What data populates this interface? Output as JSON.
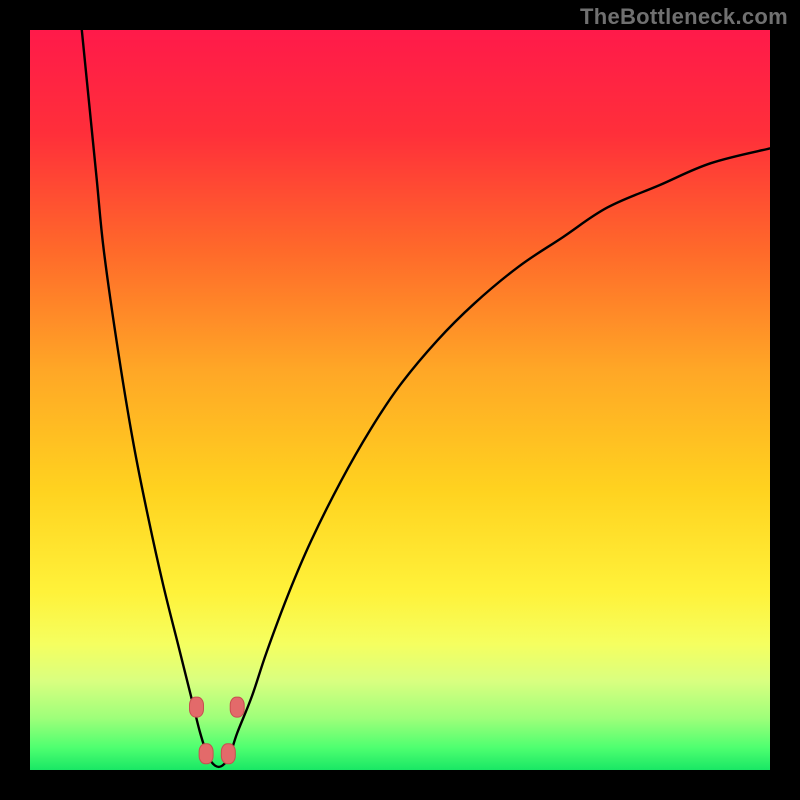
{
  "watermark": "TheBottleneck.com",
  "colors": {
    "bg": "#000000",
    "gradient_stops": [
      {
        "offset": 0.0,
        "color": "#ff1a4a"
      },
      {
        "offset": 0.14,
        "color": "#ff2f3a"
      },
      {
        "offset": 0.3,
        "color": "#ff6a2a"
      },
      {
        "offset": 0.46,
        "color": "#ffa726"
      },
      {
        "offset": 0.62,
        "color": "#ffd21f"
      },
      {
        "offset": 0.76,
        "color": "#fff23a"
      },
      {
        "offset": 0.83,
        "color": "#f5ff60"
      },
      {
        "offset": 0.88,
        "color": "#d9ff80"
      },
      {
        "offset": 0.93,
        "color": "#9eff7a"
      },
      {
        "offset": 0.97,
        "color": "#4eff70"
      },
      {
        "offset": 1.0,
        "color": "#19e765"
      }
    ],
    "curve": "#000000",
    "marker_fill": "#e36a6a",
    "marker_stroke": "#c74f4f"
  },
  "chart_data": {
    "type": "line",
    "title": "",
    "xlabel": "",
    "ylabel": "",
    "xlim": [
      0,
      100
    ],
    "ylim": [
      0,
      100
    ],
    "series": [
      {
        "name": "bottleneck-curve",
        "x": [
          7,
          8,
          9,
          10,
          12,
          14,
          16,
          18,
          20,
          21,
          22,
          23,
          24,
          25,
          26,
          27,
          28,
          30,
          32,
          35,
          38,
          42,
          46,
          50,
          55,
          60,
          66,
          72,
          78,
          85,
          92,
          100
        ],
        "y": [
          100,
          90,
          80,
          70,
          56,
          44,
          34,
          25,
          17,
          13,
          9,
          5,
          2,
          0.6,
          0.6,
          2,
          5,
          10,
          16,
          24,
          31,
          39,
          46,
          52,
          58,
          63,
          68,
          72,
          76,
          79,
          82,
          84
        ]
      }
    ],
    "markers": [
      {
        "x": 22.5,
        "y": 8.5
      },
      {
        "x": 28.0,
        "y": 8.5
      },
      {
        "x": 23.8,
        "y": 2.2
      },
      {
        "x": 26.8,
        "y": 2.2
      }
    ],
    "optimal_range_x": [
      23,
      27
    ]
  }
}
